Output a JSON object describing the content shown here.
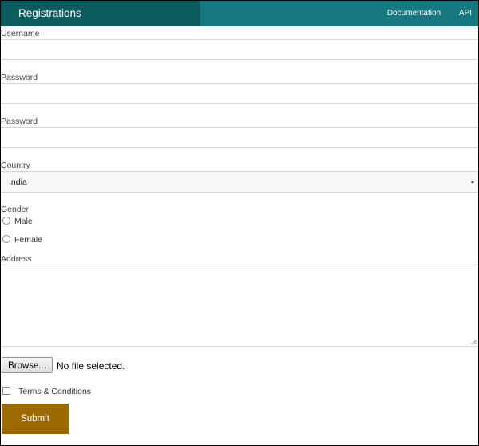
{
  "navbar": {
    "brand": "Registrations",
    "links": [
      "Documentation",
      "API"
    ]
  },
  "form": {
    "username_label": "Username",
    "username_value": "",
    "password_label": "Password",
    "password_value": "",
    "confirm_password_label": "Password",
    "confirm_password_value": "",
    "country_label": "Country",
    "country_value": "India",
    "gender_label": "Gender",
    "gender_options": [
      "Male",
      "Female"
    ],
    "address_label": "Address",
    "address_value": "",
    "browse_label": "Browse...",
    "file_status": "No file selected.",
    "terms_label": "Terms & Conditions",
    "terms_checked": false,
    "submit_label": "Submit"
  },
  "colors": {
    "navbar": "#167880",
    "brand_area": "#0c5c60",
    "submit": "#9b6a00"
  }
}
